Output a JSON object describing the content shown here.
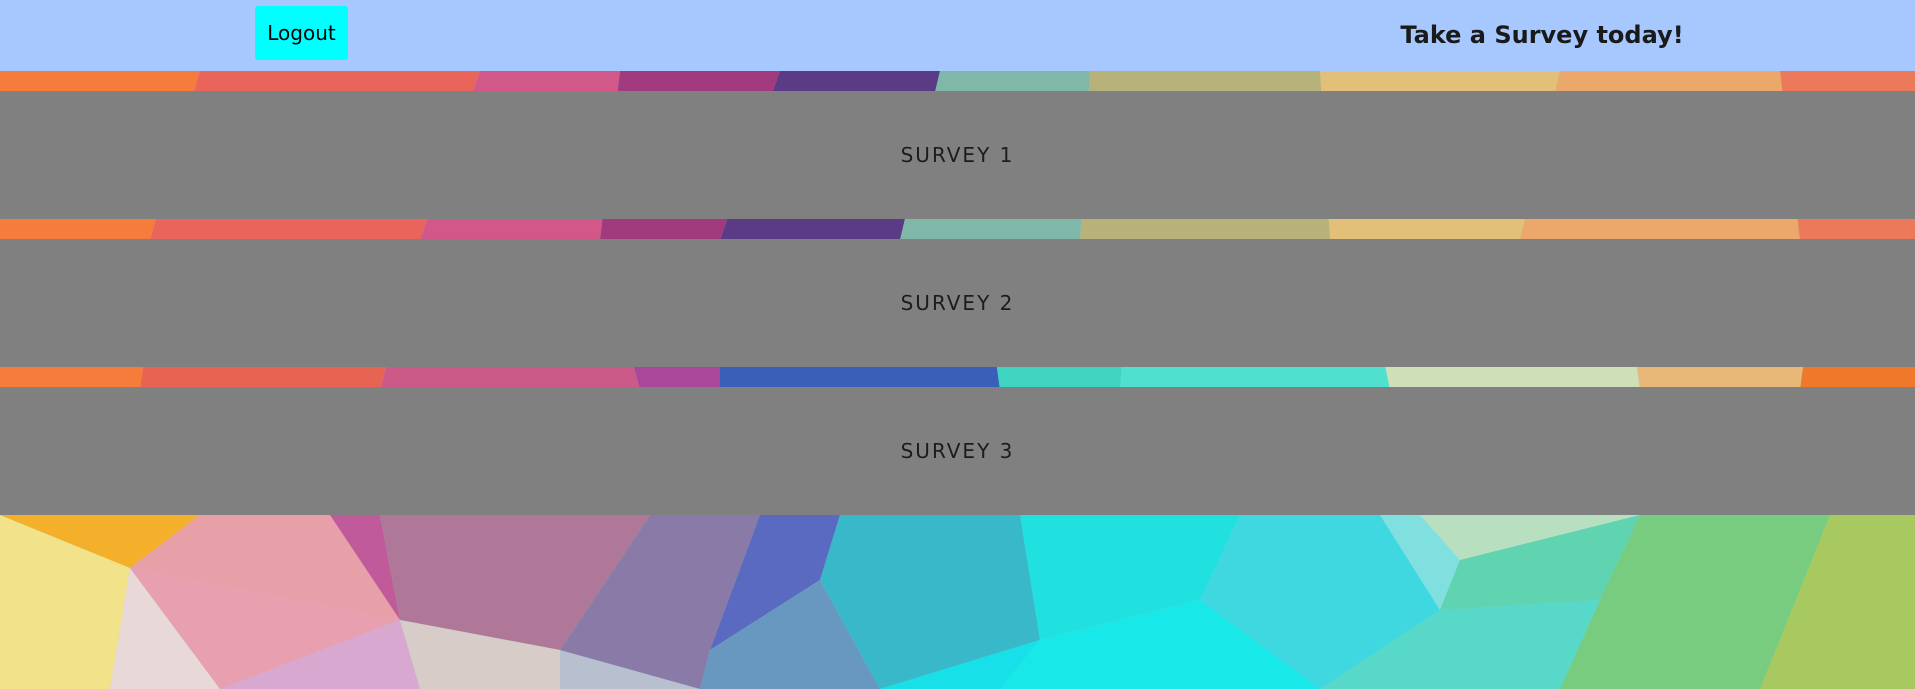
{
  "header": {
    "logout_label": "Logout",
    "title": "Take a Survey today!",
    "background_color": "#a6c8fe",
    "logout_color": "#00ffff"
  },
  "surveys": [
    {
      "label": "Survey 1"
    },
    {
      "label": "Survey 2"
    },
    {
      "label": "Survey 3"
    }
  ],
  "colors": {
    "survey_bar": "#808080"
  }
}
